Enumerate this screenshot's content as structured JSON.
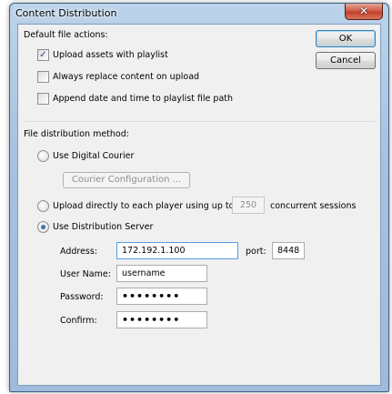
{
  "window": {
    "title": "Content Distribution",
    "close_glyph": "✕"
  },
  "default_actions": {
    "heading": "Default file actions:",
    "upload_assets": {
      "label": "Upload assets with playlist",
      "checked": true
    },
    "always_replace": {
      "label": "Always replace content on upload",
      "checked": false
    },
    "append_date": {
      "label": "Append date and time to playlist file path",
      "checked": false
    }
  },
  "buttons": {
    "ok": "OK",
    "cancel": "Cancel"
  },
  "distribution": {
    "heading": "File distribution method:",
    "digital_courier": {
      "label": "Use Digital Courier",
      "selected": false
    },
    "courier_config_button": "Courier Configuration ...",
    "upload_directly": {
      "label": "Upload directly to each player using up to",
      "sessions_value": "250",
      "sessions_suffix": "concurrent sessions",
      "selected": false
    },
    "distribution_server": {
      "label": "Use Distribution Server",
      "selected": true
    }
  },
  "server": {
    "address_label": "Address:",
    "address_value": "172.192.1.100",
    "port_label": "port:",
    "port_value": "8448",
    "username_label": "User Name:",
    "username_value": "username",
    "password_label": "Password:",
    "password_value": "••••••••",
    "confirm_label": "Confirm:",
    "confirm_value": "••••••••"
  },
  "colors": {
    "accent": "#1e4c8f",
    "titlebar": "#a7c2df",
    "close": "#c1402a"
  }
}
